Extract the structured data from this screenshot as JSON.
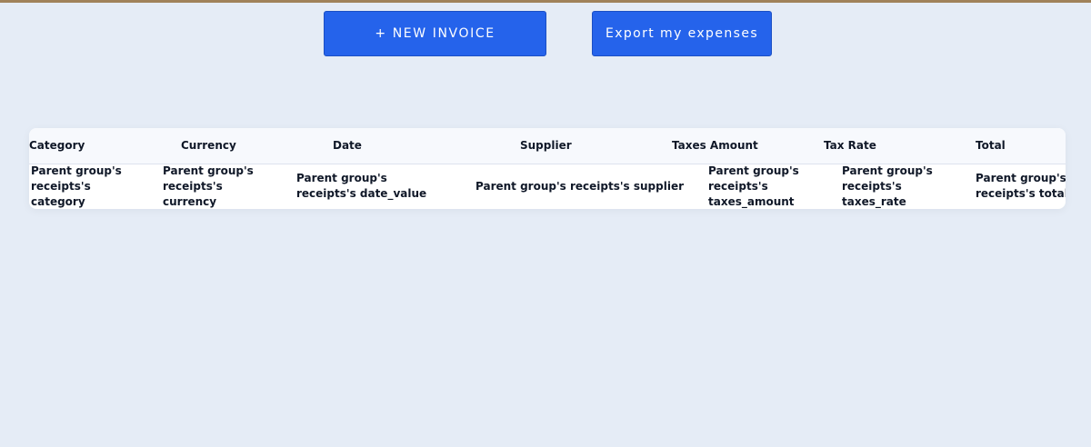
{
  "toolbar": {
    "new_invoice_label": "+ NEW INVOICE",
    "export_label": "Export my expenses"
  },
  "table": {
    "columns": [
      "Category",
      "Currency",
      "Date",
      "Supplier",
      "Taxes Amount",
      "Tax Rate",
      "Total"
    ],
    "rows": [
      {
        "category": [
          "Parent group's",
          "receipts's",
          "category"
        ],
        "currency": [
          "Parent group's",
          "receipts's",
          "currency"
        ],
        "date": [
          "Parent group's",
          "receipts's date_value"
        ],
        "supplier": "Parent group's receipts's supplier",
        "taxes_amount": [
          "Parent group's",
          "receipts's",
          "taxes_amount"
        ],
        "tax_rate": [
          "Parent group's",
          "receipts's",
          "taxes_rate"
        ],
        "total": [
          "Parent group's",
          "receipts's total"
        ]
      }
    ]
  },
  "colors": {
    "background": "#e5ecf6",
    "primary": "#2563eb",
    "text": "#101828",
    "top_border": "#a0825a"
  }
}
